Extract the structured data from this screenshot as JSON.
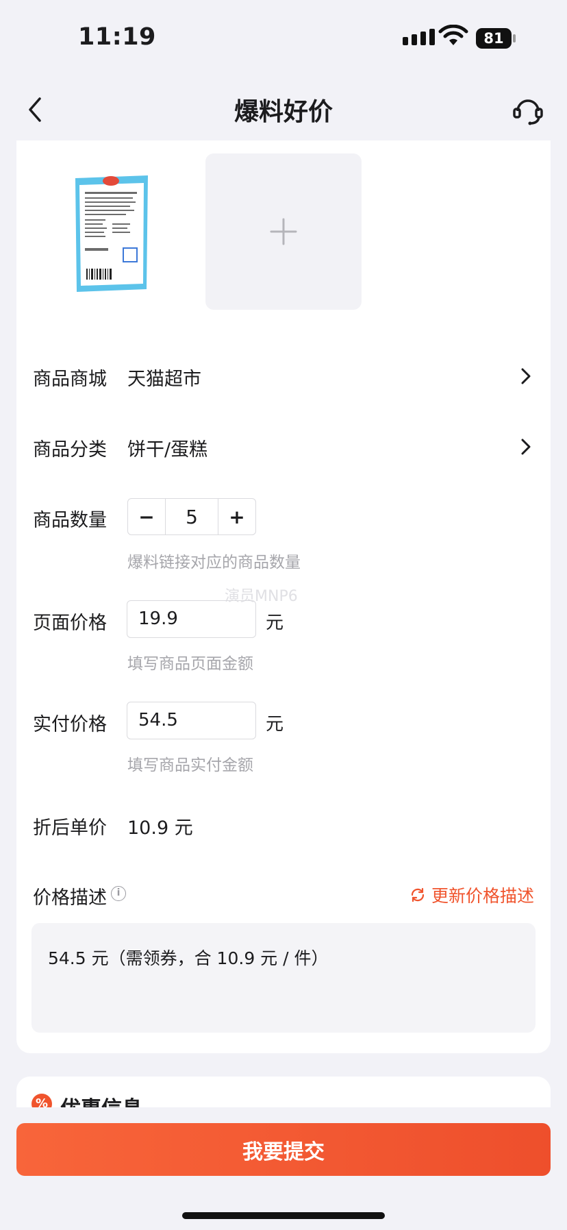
{
  "status_bar": {
    "time": "11:19",
    "battery": "81"
  },
  "nav": {
    "title": "爆料好价"
  },
  "photos": {
    "product_image_alt": "商品图片"
  },
  "form": {
    "mall": {
      "label": "商品商城",
      "value": "天猫超市"
    },
    "category": {
      "label": "商品分类",
      "value": "饼干/蛋糕"
    },
    "quantity": {
      "label": "商品数量",
      "minus": "−",
      "value": "5",
      "plus": "+",
      "hint": "爆料链接对应的商品数量"
    },
    "page_price": {
      "label": "页面价格",
      "value": "19.9",
      "unit": "元",
      "hint": "填写商品页面金额"
    },
    "paid_price": {
      "label": "实付价格",
      "value": "54.5",
      "unit": "元",
      "hint": "填写商品实付金额"
    },
    "unit_price": {
      "label": "折后单价",
      "value": "10.9 元"
    },
    "price_desc": {
      "label": "价格描述",
      "info_icon": "i",
      "refresh_label": "更新价格描述",
      "text": "54.5 元（需领券，合 10.9 元 / 件）"
    }
  },
  "watermark": "演员MNP6",
  "discount": {
    "title": "优惠信息",
    "icon": "%"
  },
  "submit": {
    "label": "我要提交"
  },
  "colors": {
    "accent": "#f0542d",
    "background": "#f2f2f7"
  }
}
